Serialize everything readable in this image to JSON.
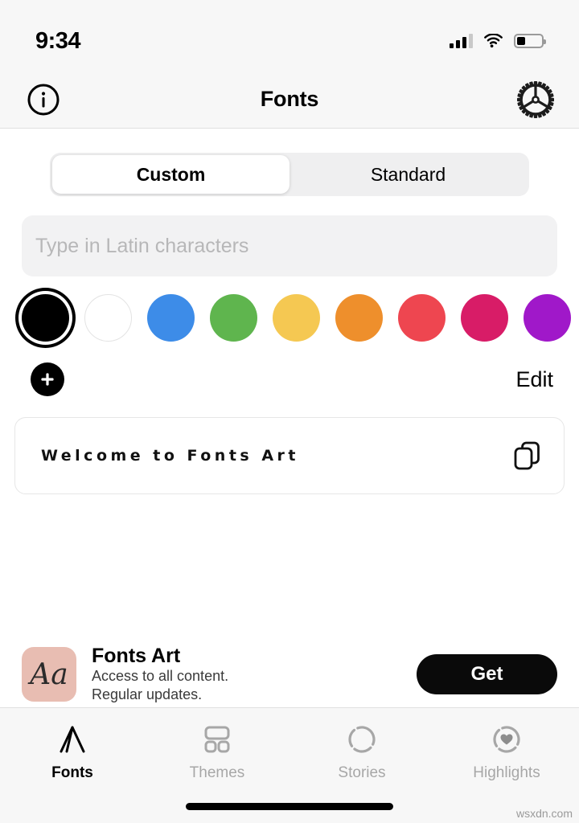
{
  "status_bar": {
    "time": "9:34",
    "signal_icon": "cellular-bars-icon",
    "wifi_icon": "wifi-icon",
    "battery_icon": "battery-icon",
    "battery_level_pct": 35
  },
  "nav_bar": {
    "info_icon": "info-circle-icon",
    "title": "Fonts",
    "settings_icon": "gear-icon"
  },
  "segmented_control": {
    "options": [
      {
        "label": "Custom",
        "selected": true
      },
      {
        "label": "Standard",
        "selected": false
      }
    ]
  },
  "input": {
    "placeholder": "Type in Latin characters",
    "value": ""
  },
  "colors": {
    "swatches": [
      {
        "name": "black",
        "hex": "#000000",
        "selected": true
      },
      {
        "name": "white",
        "hex": "#ffffff",
        "selected": false
      },
      {
        "name": "blue",
        "hex": "#3d8ce8",
        "selected": false
      },
      {
        "name": "green",
        "hex": "#5fb54e",
        "selected": false
      },
      {
        "name": "yellow",
        "hex": "#f5c852",
        "selected": false
      },
      {
        "name": "orange",
        "hex": "#ee8f2c",
        "selected": false
      },
      {
        "name": "red",
        "hex": "#ee4650",
        "selected": false
      },
      {
        "name": "magenta",
        "hex": "#d81c67",
        "selected": false
      },
      {
        "name": "purple",
        "hex": "#a018c9",
        "selected": false
      }
    ],
    "add_icon": "plus-icon",
    "edit_label": "Edit"
  },
  "preview": {
    "text": "Welcome to Fonts Art",
    "copy_icon": "copy-icon"
  },
  "ad_banner": {
    "icon_text": "Aa",
    "icon_bg": "#e8bdb2",
    "title": "Fonts Art",
    "line1": "Access to all content.",
    "line2": "Regular updates.",
    "cta_label": "Get"
  },
  "tab_bar": {
    "tabs": [
      {
        "label": "Fonts",
        "icon": "letter-a-icon",
        "active": true
      },
      {
        "label": "Themes",
        "icon": "grid-layout-icon",
        "active": false
      },
      {
        "label": "Stories",
        "icon": "dashed-circle-icon",
        "active": false
      },
      {
        "label": "Highlights",
        "icon": "heart-circle-icon",
        "active": false
      }
    ]
  },
  "watermark": {
    "text": "wsxdn.com"
  }
}
